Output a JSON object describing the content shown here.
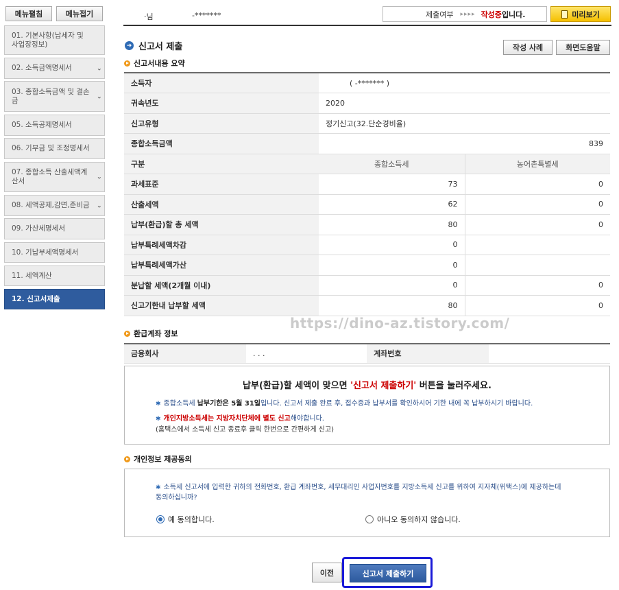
{
  "sidebar": {
    "expand_label": "메뉴펼침",
    "collapse_label": "메뉴접기",
    "items": [
      {
        "label": "01. 기본사항(납세자 및 사업장정보)"
      },
      {
        "label": "02. 소득금액명세서"
      },
      {
        "label": "03. 종합소득금액 및 결손금"
      },
      {
        "label": "05. 소득공제명세서"
      },
      {
        "label": "06. 기부금 및 조정명세서"
      },
      {
        "label": "07. 종합소득 산출세액계산서"
      },
      {
        "label": "08. 세액공제,감면,준비금"
      },
      {
        "label": "09. 가산세명세서"
      },
      {
        "label": "10. 기납부세액명세서"
      },
      {
        "label": "11. 세액계산"
      },
      {
        "label": "12. 신고서제출"
      }
    ]
  },
  "header": {
    "user_name": "·님",
    "user_id": "-*******",
    "status_label": "제출여부",
    "status_arrows": "▸▸▸▸",
    "status_value": "작성중",
    "status_suffix": "입니다.",
    "preview_label": "미리보기"
  },
  "page": {
    "title": "신고서 제출",
    "sample_btn": "작성 사례",
    "help_btn": "화면도움말",
    "summary_title": "신고서내용 요약",
    "refund_title": "환급계좌 정보",
    "consent_title": "개인정보 제공동의"
  },
  "summary": {
    "taxpayer_label": "소득자",
    "taxpayer_value": "(            -*******  )",
    "year_label": "귀속년도",
    "year_value": "2020",
    "type_label": "신고유형",
    "type_value": "정기신고(32.단순경비율)",
    "income_label": "종합소득금액",
    "income_value": "839",
    "col_label": "구분",
    "col1": "종합소득세",
    "col2": "농어촌특별세",
    "rows": [
      {
        "label": "과세표준",
        "v1": "73",
        "v2": "0"
      },
      {
        "label": "산출세액",
        "v1": "62",
        "v2": "0"
      },
      {
        "label": "납부(환급)할 총 세액",
        "v1": "80",
        "v2": "0"
      },
      {
        "label": "납부특례세액차감",
        "v1": "0",
        "v2": ""
      },
      {
        "label": "납부특례세액가산",
        "v1": "0",
        "v2": ""
      },
      {
        "label": "분납할 세액(2개월 이내)",
        "v1": "0",
        "v2": "0"
      },
      {
        "label": "신고기한내 납부할 세액",
        "v1": "80",
        "v2": "0"
      }
    ]
  },
  "watermark": "https://dino-az.tistory.com/",
  "refund": {
    "bank_label": "금융회사",
    "bank_value": ".  .  .",
    "account_label": "계좌번호",
    "account_value": ""
  },
  "notice": {
    "head_pre": "납부(환급)할 세액이 맞으면 ",
    "head_red": "'신고서 제출하기'",
    "head_post": " 버튼을 눌러주세요.",
    "line1_pre": "종합소득세 ",
    "line1_bold": "납부기한은 5월 31일",
    "line1_post": "입니다. 신고서 제출 완료 후, 접수증과 납부서를 확인하시어 기한 내에 꼭 납부하시기 바랍니다.",
    "line2_red": "개인지방소득세는 지방자치단체에 별도 신고",
    "line2_post": "해야합니다.",
    "line3": "(홈택스에서 소득세 신고 종료후 클릭 한번으로 간편하게 신고)"
  },
  "consent": {
    "text": "소득세 신고서에 입력한 귀하의 전화번호, 환급 계좌번호, 세무대리인 사업자번호를 지방소득세 신고를 위하여 지자체(위택스)에 제공하는데 동의하십니까?",
    "yes": "예 동의합니다.",
    "no": "아니오 동의하지 않습니다."
  },
  "buttons": {
    "prev": "이전",
    "submit": "신고서 제출하기"
  }
}
